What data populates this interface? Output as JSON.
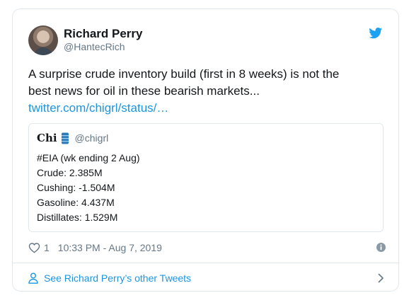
{
  "author": {
    "name": "Richard Perry",
    "handle": "@HantecRich"
  },
  "tweet": {
    "text_line_1": "A surprise crude inventory build (first in 8 weeks) is not the",
    "text_line_2": "best news for oil in these bearish markets...",
    "link": "twitter.com/chigrl/status/…"
  },
  "quoted_tweet": {
    "name": "Chi",
    "handle": "@chigrl",
    "lines": [
      "#EIA (wk ending 2 Aug)",
      "Crude: 2.385M",
      "Cushing: -1.504M",
      "Gasoline: 4.437M",
      "Distillates: 1.529M"
    ]
  },
  "meta": {
    "likes": "1",
    "timestamp": "10:33 PM - Aug 7, 2019"
  },
  "footer": {
    "label": "See Richard Perry’s other Tweets"
  },
  "icons": {
    "logo": "twitter-bird-icon",
    "badge": "oil-barrel-icon",
    "like": "heart-outline-icon",
    "info": "info-icon",
    "profile": "person-icon",
    "more": "chevron-right-icon"
  },
  "colors": {
    "brand_blue": "#1da1f2",
    "link_blue": "#1b95e0",
    "secondary_text": "#657786",
    "border": "#e1e8ed"
  }
}
